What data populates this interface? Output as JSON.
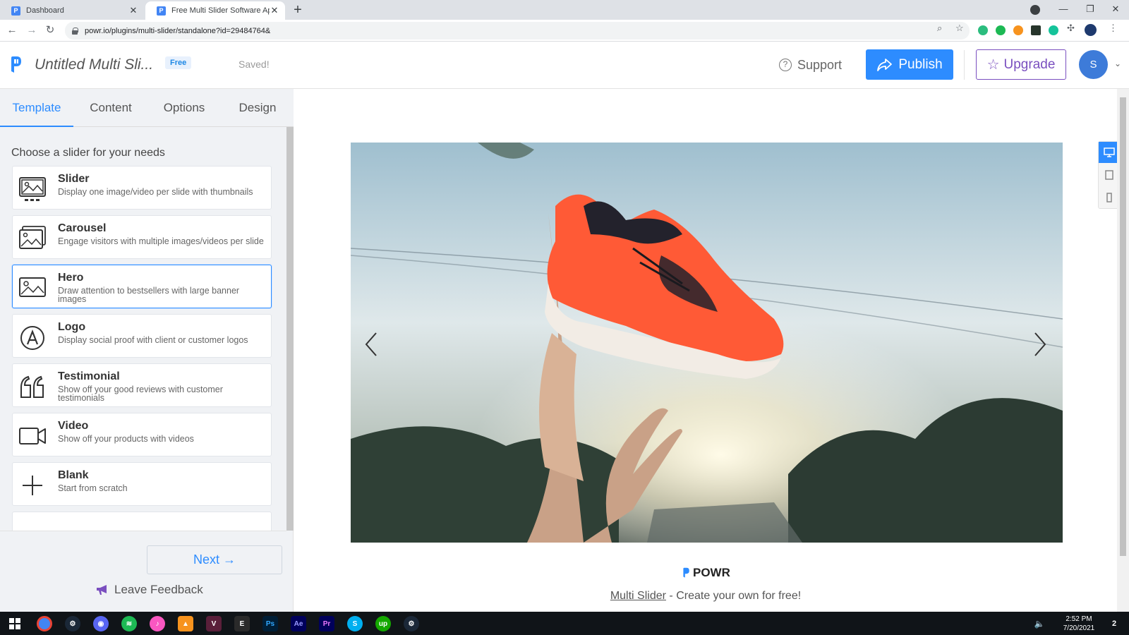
{
  "browser": {
    "tabs": [
      {
        "title": "Dashboard",
        "active": false
      },
      {
        "title": "Free Multi Slider Software Applic",
        "active": true
      }
    ],
    "url": "powr.io/plugins/multi-slider/standalone?id=29484764&"
  },
  "header": {
    "title": "Untitled Multi Sli...",
    "plan_badge": "Free",
    "save_status": "Saved!",
    "support_label": "Support",
    "publish_label": "Publish",
    "upgrade_label": "Upgrade",
    "avatar_initial": "S"
  },
  "sidebar": {
    "tabs": [
      {
        "label": "Template",
        "active": true
      },
      {
        "label": "Content",
        "active": false
      },
      {
        "label": "Options",
        "active": false
      },
      {
        "label": "Design",
        "active": false
      }
    ],
    "heading": "Choose a slider for your needs",
    "templates": [
      {
        "name": "Slider",
        "desc": "Display one image/video per slide with thumbnails",
        "icon": "slider-icon",
        "selected": false
      },
      {
        "name": "Carousel",
        "desc": "Engage visitors with multiple images/videos per slide",
        "icon": "carousel-icon",
        "selected": false
      },
      {
        "name": "Hero",
        "desc": "Draw attention to bestsellers with large banner images",
        "icon": "hero-icon",
        "selected": true
      },
      {
        "name": "Logo",
        "desc": "Display social proof with client or customer logos",
        "icon": "logo-a-icon",
        "selected": false
      },
      {
        "name": "Testimonial",
        "desc": "Show off your good reviews with customer testimonials",
        "icon": "quote-icon",
        "selected": false
      },
      {
        "name": "Video",
        "desc": "Show off your products with videos",
        "icon": "video-camera-icon",
        "selected": false
      },
      {
        "name": "Blank",
        "desc": "Start from scratch",
        "icon": "plus-icon",
        "selected": false
      }
    ],
    "next_label": "Next →",
    "feedback_label": "Leave Feedback"
  },
  "preview": {
    "brand": "POWR",
    "tagline_link": "Multi Slider",
    "tagline_rest": " - Create your own for free!"
  },
  "taskbar": {
    "time": "2:52 PM",
    "date": "7/20/2021",
    "notification_count": "2"
  },
  "colors": {
    "accent": "#2d8cff",
    "upgrade": "#7a4fbf",
    "sidebar_bg": "#f0f2f5"
  }
}
